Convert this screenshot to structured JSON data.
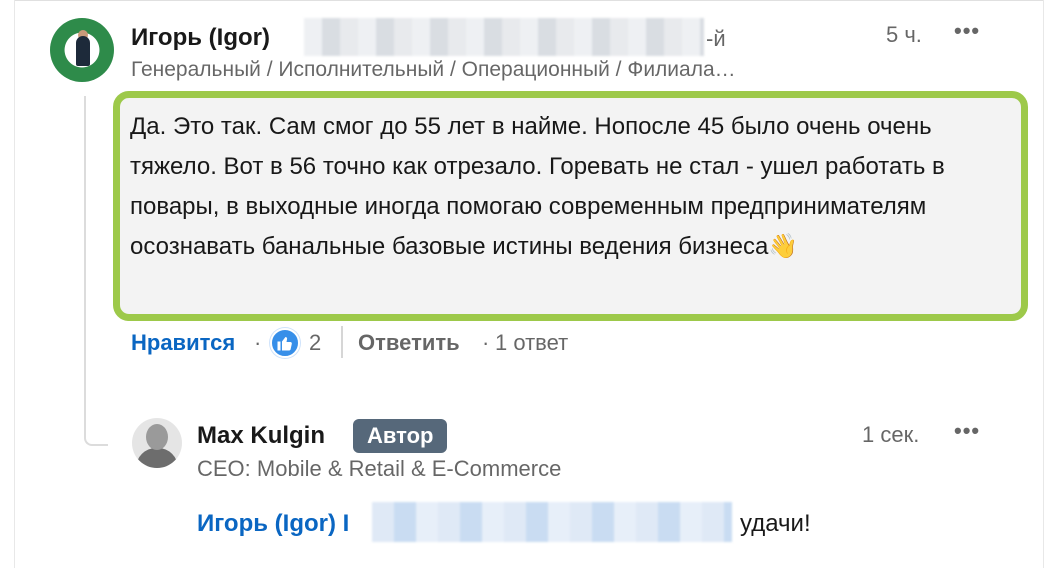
{
  "comment": {
    "author_name": "Игорь (Igor)",
    "author_suffix": "-й",
    "timestamp": "5 ч.",
    "more_label": "•••",
    "headline": "Генеральный / Исполнительный / Операционный / Филиала…",
    "text": "Да. Это так. Сам смог до 55 лет в найме. Нопосле 45 было очень очень тяжело. Вот в 56 точно как отрезало. Горевать не стал - ушел работать в повары, в выходные иногда помогаю современным предпринимателям осознавать банальные базовые истины ведения бизнеса👋",
    "highlight_color": "#9dc94a",
    "actions": {
      "like_label": "Нравится",
      "separator": "·",
      "like_count": "2",
      "reply_label": "Ответить",
      "reply_count": "1 ответ"
    }
  },
  "reply": {
    "author_name": "Max Kulgin",
    "author_badge": "Автор",
    "timestamp": "1 сек.",
    "more_label": "•••",
    "headline": "CEO: Mobile & Retail & E-Commerce",
    "mention": "Игорь (Igor) I",
    "text_end": "удачи!"
  },
  "colors": {
    "link_blue": "#0a66c2",
    "like_icon_blue": "#378fe9",
    "badge_gray": "#56687a"
  }
}
